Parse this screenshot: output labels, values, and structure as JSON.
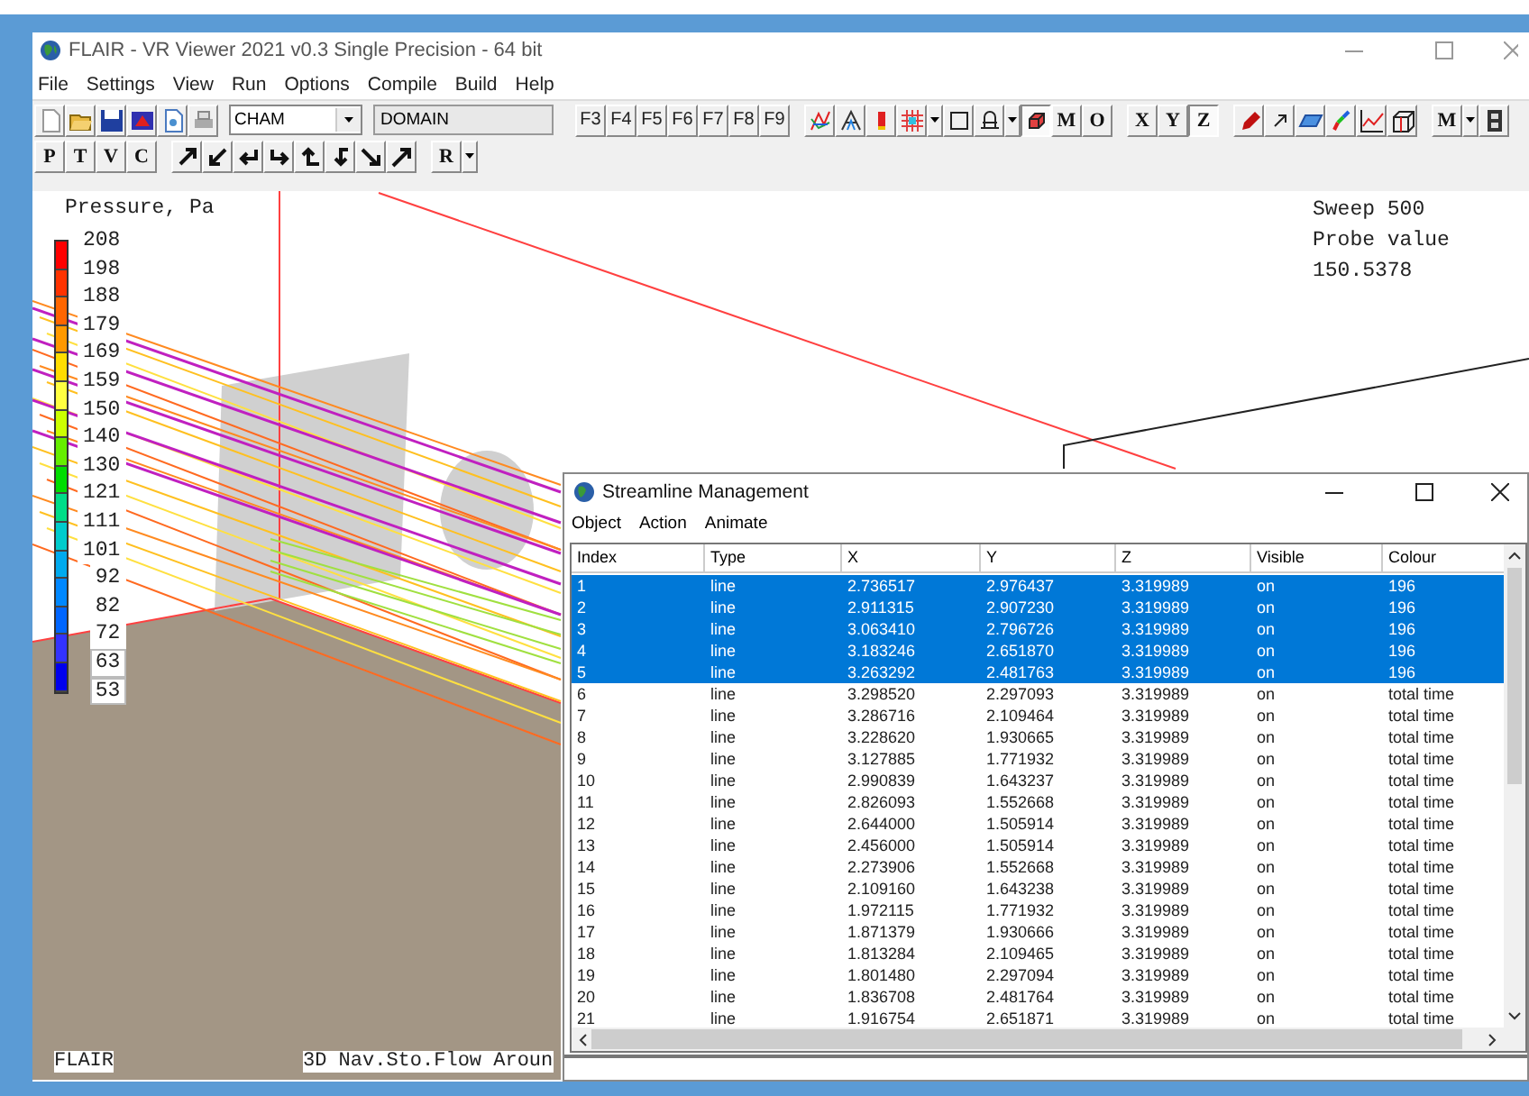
{
  "window": {
    "title": "FLAIR - VR Viewer 2021 v0.3 Single Precision - 64 bit"
  },
  "menu": [
    "File",
    "Settings",
    "View",
    "Run",
    "Options",
    "Compile",
    "Build",
    "Help"
  ],
  "toolbar1": {
    "combo": "CHAM",
    "field": "DOMAIN",
    "keys": [
      "F3",
      "F4",
      "F5",
      "F6",
      "F7",
      "F8",
      "F9"
    ],
    "letters": [
      "M",
      "O"
    ],
    "axes": [
      {
        "label": "X",
        "selected": false
      },
      {
        "label": "Y",
        "selected": false
      },
      {
        "label": "Z",
        "selected": true
      }
    ],
    "mode": "M"
  },
  "toolbar2": {
    "letters": [
      "P",
      "T",
      "V",
      "C"
    ],
    "mode": "R"
  },
  "viewport": {
    "legend": {
      "title": "Pressure, Pa",
      "ticks": [
        "208",
        "198",
        "188",
        "179",
        "169",
        "159",
        "150",
        "140",
        "130",
        "121",
        "111",
        "101",
        "92",
        "82",
        "72",
        "63",
        "53"
      ],
      "bands": [
        {
          "color": "#ff0000"
        },
        {
          "color": "#ff3300"
        },
        {
          "color": "#ff6600"
        },
        {
          "color": "#ff9900"
        },
        {
          "color": "#ffdd00"
        },
        {
          "color": "#ffff40"
        },
        {
          "color": "#ccff00"
        },
        {
          "color": "#66ee00"
        },
        {
          "color": "#00dd00"
        },
        {
          "color": "#00dd88"
        },
        {
          "color": "#00cccc"
        },
        {
          "color": "#00aaee"
        },
        {
          "color": "#0088ff"
        },
        {
          "color": "#0066ff"
        },
        {
          "color": "#3333ff"
        },
        {
          "color": "#0000ee"
        }
      ]
    },
    "info": [
      "Sweep 500",
      "Probe value",
      "150.5378"
    ],
    "status_left": "FLAIR",
    "status_title": "3D Nav.Sto.Flow Aroun"
  },
  "dialog": {
    "title": "Streamline Management",
    "menu": [
      "Object",
      "Action",
      "Animate"
    ],
    "columns": [
      "Index",
      "Type",
      "X",
      "Y",
      "Z",
      "Visible",
      "Colour"
    ],
    "rows": [
      {
        "selected": true,
        "cells": [
          "1",
          "line",
          "2.736517",
          "2.976437",
          "3.319989",
          "on",
          "196"
        ]
      },
      {
        "selected": true,
        "cells": [
          "2",
          "line",
          "2.911315",
          "2.907230",
          "3.319989",
          "on",
          "196"
        ]
      },
      {
        "selected": true,
        "cells": [
          "3",
          "line",
          "3.063410",
          "2.796726",
          "3.319989",
          "on",
          "196"
        ]
      },
      {
        "selected": true,
        "cells": [
          "4",
          "line",
          "3.183246",
          "2.651870",
          "3.319989",
          "on",
          "196"
        ]
      },
      {
        "selected": true,
        "cells": [
          "5",
          "line",
          "3.263292",
          "2.481763",
          "3.319989",
          "on",
          "196"
        ]
      },
      {
        "selected": false,
        "cells": [
          "6",
          "line",
          "3.298520",
          "2.297093",
          "3.319989",
          "on",
          "total time"
        ]
      },
      {
        "selected": false,
        "cells": [
          "7",
          "line",
          "3.286716",
          "2.109464",
          "3.319989",
          "on",
          "total time"
        ]
      },
      {
        "selected": false,
        "cells": [
          "8",
          "line",
          "3.228620",
          "1.930665",
          "3.319989",
          "on",
          "total time"
        ]
      },
      {
        "selected": false,
        "cells": [
          "9",
          "line",
          "3.127885",
          "1.771932",
          "3.319989",
          "on",
          "total time"
        ]
      },
      {
        "selected": false,
        "cells": [
          "10",
          "line",
          "2.990839",
          "1.643237",
          "3.319989",
          "on",
          "total time"
        ]
      },
      {
        "selected": false,
        "cells": [
          "11",
          "line",
          "2.826093",
          "1.552668",
          "3.319989",
          "on",
          "total time"
        ]
      },
      {
        "selected": false,
        "cells": [
          "12",
          "line",
          "2.644000",
          "1.505914",
          "3.319989",
          "on",
          "total time"
        ]
      },
      {
        "selected": false,
        "cells": [
          "13",
          "line",
          "2.456000",
          "1.505914",
          "3.319989",
          "on",
          "total time"
        ]
      },
      {
        "selected": false,
        "cells": [
          "14",
          "line",
          "2.273906",
          "1.552668",
          "3.319989",
          "on",
          "total time"
        ]
      },
      {
        "selected": false,
        "cells": [
          "15",
          "line",
          "2.109160",
          "1.643238",
          "3.319989",
          "on",
          "total time"
        ]
      },
      {
        "selected": false,
        "cells": [
          "16",
          "line",
          "1.972115",
          "1.771932",
          "3.319989",
          "on",
          "total time"
        ]
      },
      {
        "selected": false,
        "cells": [
          "17",
          "line",
          "1.871379",
          "1.930666",
          "3.319989",
          "on",
          "total time"
        ]
      },
      {
        "selected": false,
        "cells": [
          "18",
          "line",
          "1.813284",
          "2.109465",
          "3.319989",
          "on",
          "total time"
        ]
      },
      {
        "selected": false,
        "cells": [
          "19",
          "line",
          "1.801480",
          "2.297094",
          "3.319989",
          "on",
          "total time"
        ]
      },
      {
        "selected": false,
        "cells": [
          "20",
          "line",
          "1.836708",
          "2.481764",
          "3.319989",
          "on",
          "total time"
        ]
      },
      {
        "selected": false,
        "cells": [
          "21",
          "line",
          "1.916754",
          "2.651871",
          "3.319989",
          "on",
          "total time"
        ]
      }
    ]
  }
}
